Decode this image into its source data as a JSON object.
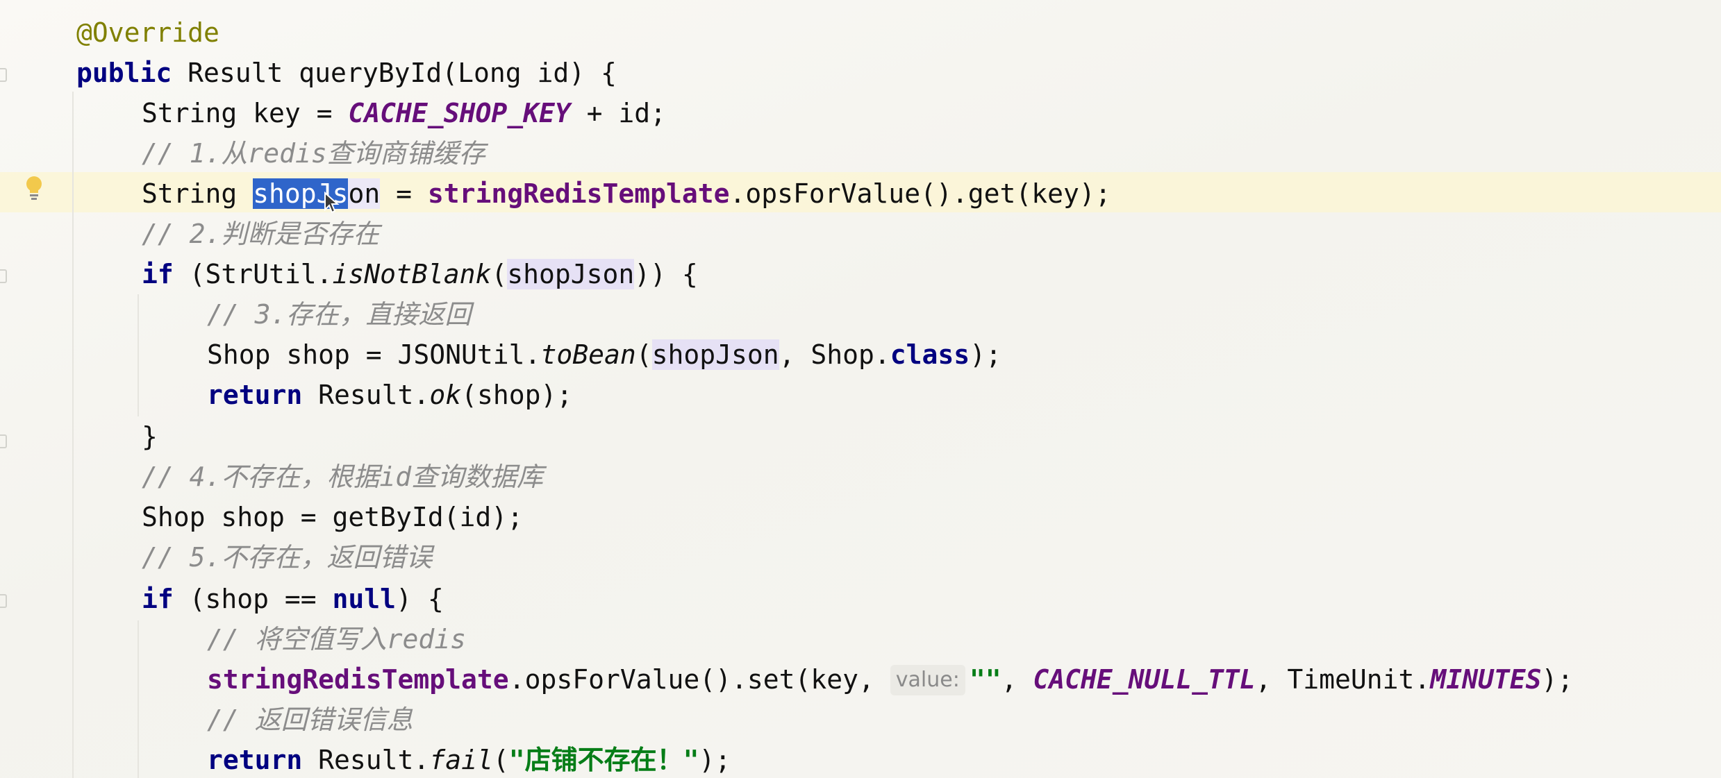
{
  "code": {
    "l1": {
      "annotation": "@Override"
    },
    "l2": {
      "kw_public": "public",
      "t1": " Result queryById(Long id) {"
    },
    "l3": {
      "t1": "String key = ",
      "const": "CACHE_SHOP_KEY",
      "t2": " + id;"
    },
    "l4": {
      "comment": "// 1.从redis查询商铺缓存"
    },
    "l5": {
      "t1": "String ",
      "sel": "shopJs",
      "usage_tail": "on",
      "t2": " = ",
      "field": "stringRedisTemplate",
      "t3": ".opsForValue().get(key);"
    },
    "l6": {
      "comment": "// 2.判断是否存在"
    },
    "l7": {
      "kw_if": "if",
      "t1": " (StrUtil.",
      "static": "isNotBlank",
      "t2": "(",
      "usage": "shopJson",
      "t3": ")) {"
    },
    "l8": {
      "comment": "// 3.存在，直接返回"
    },
    "l9": {
      "t1": "Shop shop = JSONUtil.",
      "static": "toBean",
      "t2": "(",
      "usage": "shopJson",
      "t3": ", Shop.",
      "kw_class": "class",
      "t4": ");"
    },
    "l10": {
      "kw_return": "return",
      "t1": " Result.",
      "static": "ok",
      "t2": "(shop);"
    },
    "l11": {
      "t1": "}"
    },
    "l12": {
      "comment": "// 4.不存在，根据id查询数据库"
    },
    "l13": {
      "t1": "Shop shop = getById(id);"
    },
    "l14": {
      "comment": "// 5.不存在，返回错误"
    },
    "l15": {
      "kw_if": "if",
      "t1": " (shop == ",
      "kw_null": "null",
      "t2": ") {"
    },
    "l16": {
      "comment": "// 将空值写入redis"
    },
    "l17": {
      "field": "stringRedisTemplate",
      "t1": ".opsForValue().set(key, ",
      "hint": "value:",
      "str": "\"\"",
      "t2": ", ",
      "const1": "CACHE_NULL_TTL",
      "t3": ", TimeUnit.",
      "const2": "MINUTES",
      "t4": ");"
    },
    "l18": {
      "comment": "// 返回错误信息"
    },
    "l19": {
      "kw_return": "return",
      "t1": " Result.",
      "static": "fail",
      "t2": "(",
      "str": "\"店铺不存在！\"",
      "t3": ");"
    }
  },
  "icons": {
    "bulb": "lightbulb-icon",
    "cursor": "mouse-pointer-icon"
  },
  "colors": {
    "keyword": "#000080",
    "constant": "#660e7a",
    "comment": "#8c8c8c",
    "string": "#067d17",
    "annotation": "#808000",
    "selection": "#2f65ca",
    "current_line": "#fcf6d2"
  }
}
